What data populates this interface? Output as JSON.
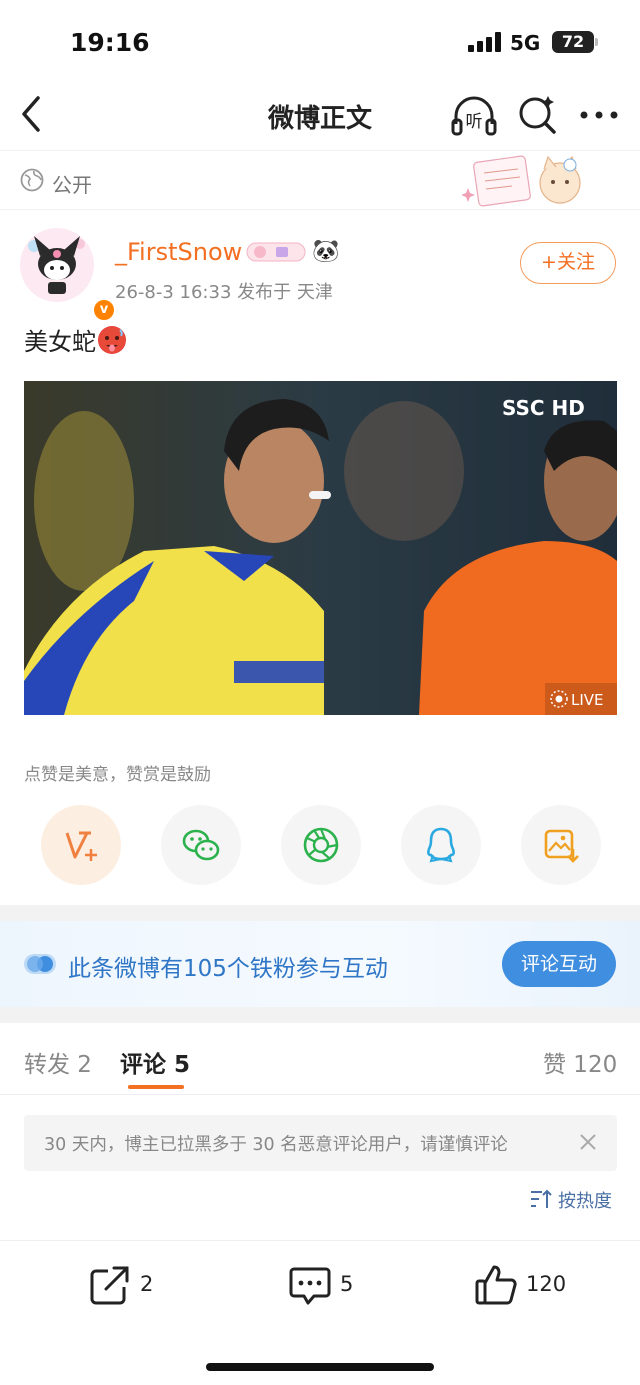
{
  "status_bar": {
    "time": "19:16",
    "network": "5G",
    "battery": "72"
  },
  "nav": {
    "title": "微博正文",
    "listen_label": "听"
  },
  "post": {
    "visibility": "公开",
    "username": "_FirstSnow",
    "meta": "26-8-3 16:33  发布于 天津",
    "follow_label": "+关注",
    "text": "美女蛇",
    "video_live": "LIVE",
    "video_watermark": "SSC HD"
  },
  "reward_hint": "点赞是美意，赞赏是鼓励",
  "share_targets": [
    "reward-icon",
    "wechat-icon",
    "moments-icon",
    "qq-icon",
    "save-image-icon"
  ],
  "interaction_banner": {
    "text": "此条微博有105个铁粉参与互动",
    "button": "评论互动"
  },
  "tabs": {
    "repost": "转发 2",
    "comments": "评论 5",
    "likes": "赞 120"
  },
  "notice": "30 天内，博主已拉黑多于 30 名恶意评论用户，请谨慎评论",
  "sort_label": "按热度",
  "bottom_bar": {
    "repost_count": "2",
    "comment_count": "5",
    "like_count": "120"
  },
  "colors": {
    "accent_orange": "#f36f21",
    "link_blue": "#2f76c6",
    "button_blue": "#3f8ee0"
  }
}
